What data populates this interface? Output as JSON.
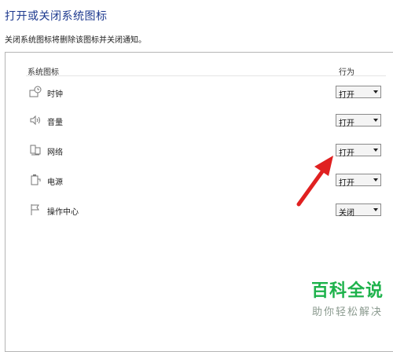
{
  "page": {
    "title": "打开或关闭系统图标",
    "description": "关闭系统图标将删除该图标并关闭通知。"
  },
  "table": {
    "headers": {
      "icons": "系统图标",
      "behavior": "行为"
    },
    "rows": [
      {
        "label": "时钟",
        "icon": "clock-icon",
        "value": "打开"
      },
      {
        "label": "音量",
        "icon": "volume-icon",
        "value": "打开"
      },
      {
        "label": "网络",
        "icon": "network-icon",
        "value": "打开"
      },
      {
        "label": "电源",
        "icon": "power-icon",
        "value": "打开"
      },
      {
        "label": "操作中心",
        "icon": "action-center-flag-icon",
        "value": "关闭"
      }
    ]
  },
  "annotation": {
    "arrow_color": "#e02020",
    "points_to": "网络"
  },
  "watermark": {
    "brand": "百科全说",
    "slogan": "助你轻松解决"
  }
}
